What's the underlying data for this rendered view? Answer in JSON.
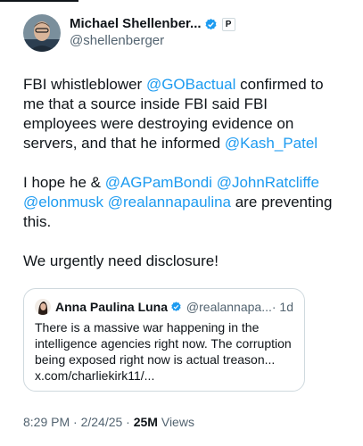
{
  "author": {
    "name": "Michael Shellenber...",
    "handle": "@shellenberger",
    "affiliate_badge": "P"
  },
  "tweet": {
    "p1_a": "FBI whistleblower ",
    "p1_mention1": "@GOBactual",
    "p1_b": " confirmed to me that a source inside FBI said FBI employees were destroying evidence on servers, and that he informed  ",
    "p1_mention2": "@Kash_Patel",
    "p2_a": "I hope he & ",
    "p2_mention1": "@AGPamBondi",
    "p2_mention2": "@JohnRatcliffe",
    "p2_mention3": "@elonmusk",
    "p2_mention4": "@realannapaulina",
    "p2_b": " are preventing this.",
    "p3": "We urgently need disclosure!"
  },
  "quote": {
    "name": "Anna Paulina Luna",
    "handle": "@realannapa...",
    "time": "· 1d",
    "text": "There is a massive war happening in the intelligence agencies right now. The corruption being exposed right now is actual treason... x.com/charliekirk11/..."
  },
  "meta": {
    "timestamp": "8:29 PM · 2/24/25 · ",
    "views_count": "25M",
    "views_label": " Views"
  },
  "colors": {
    "link": "#1d9bf0",
    "verified": "#1d9bf0",
    "secondary_text": "#536471"
  }
}
